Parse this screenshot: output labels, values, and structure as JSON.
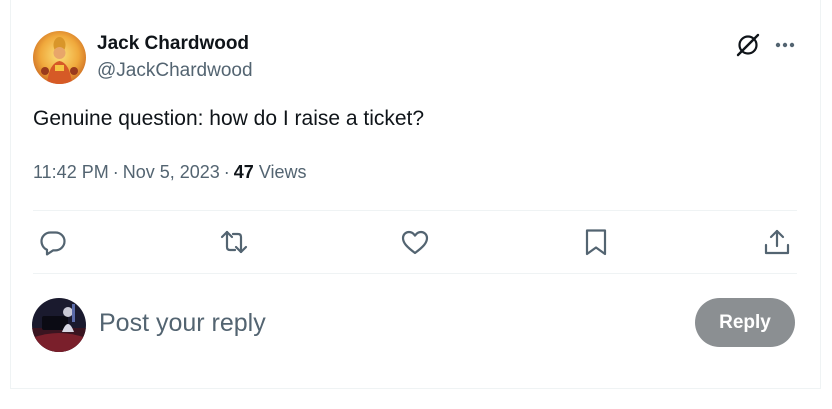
{
  "tweet": {
    "author": {
      "display_name": "Jack Chardwood",
      "handle": "@JackChardwood"
    },
    "text": "Genuine question: how do I raise a ticket?",
    "time": "11:42 PM",
    "separator": "·",
    "date": "Nov 5, 2023",
    "views_count": "47",
    "views_label": "Views"
  },
  "icons": {
    "header": [
      "grok-icon",
      "more-icon"
    ],
    "actions": [
      "reply-icon",
      "retweet-icon",
      "like-icon",
      "bookmark-icon",
      "share-icon"
    ]
  },
  "reply_box": {
    "placeholder": "Post your reply",
    "button_label": "Reply",
    "button_color": "#8b8f92"
  }
}
